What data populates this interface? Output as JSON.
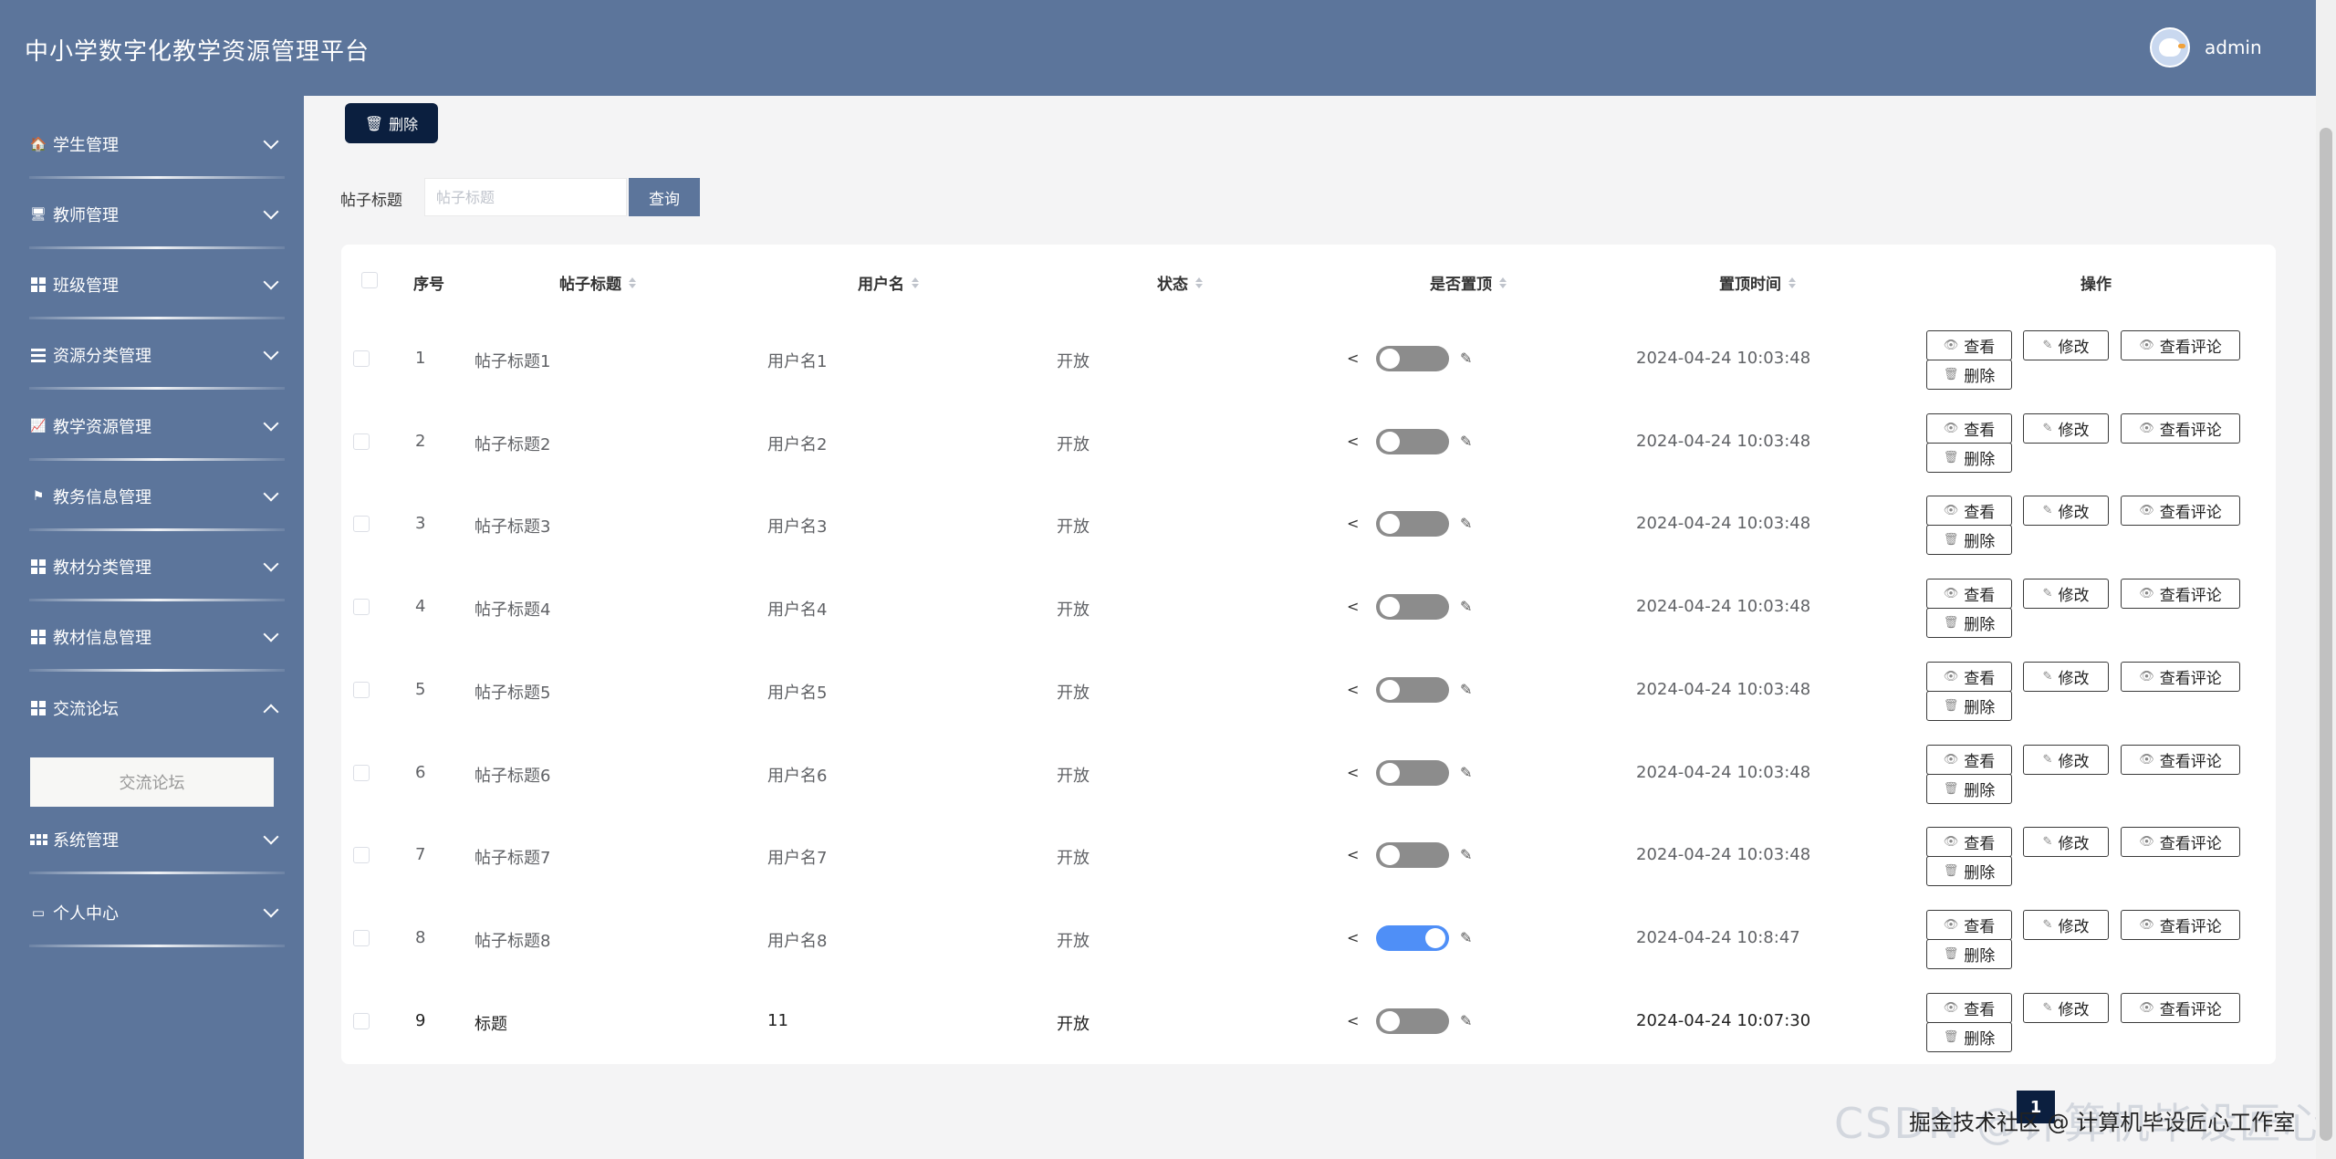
{
  "header": {
    "title": "中小学数字化教学资源管理平台",
    "username": "admin"
  },
  "sidebar": {
    "items": [
      {
        "label": "学生管理",
        "icon": "student-icon"
      },
      {
        "label": "教师管理",
        "icon": "monitor-icon"
      },
      {
        "label": "班级管理",
        "icon": "grid-icon"
      },
      {
        "label": "资源分类管理",
        "icon": "list-icon"
      },
      {
        "label": "教学资源管理",
        "icon": "chart-icon"
      },
      {
        "label": "教务信息管理",
        "icon": "flag-icon"
      },
      {
        "label": "教材分类管理",
        "icon": "grid-icon"
      },
      {
        "label": "教材信息管理",
        "icon": "grid-icon"
      },
      {
        "label": "交流论坛",
        "icon": "grid-icon",
        "expanded": true
      },
      {
        "label": "系统管理",
        "icon": "table-icon"
      },
      {
        "label": "个人中心",
        "icon": "card-icon"
      }
    ],
    "submenu": {
      "label": "交流论坛"
    }
  },
  "toolbar": {
    "delete_label": "删除"
  },
  "search": {
    "label": "帖子标题",
    "placeholder": "帖子标题",
    "button": "查询"
  },
  "table": {
    "columns": [
      "序号",
      "帖子标题",
      "用户名",
      "状态",
      "是否置顶",
      "置顶时间",
      "操作"
    ],
    "rows": [
      {
        "index": "1",
        "title": "帖子标题1",
        "user": "用户名1",
        "status": "开放",
        "pinned": false,
        "time": "2024-04-24 10:03:48"
      },
      {
        "index": "2",
        "title": "帖子标题2",
        "user": "用户名2",
        "status": "开放",
        "pinned": false,
        "time": "2024-04-24 10:03:48"
      },
      {
        "index": "3",
        "title": "帖子标题3",
        "user": "用户名3",
        "status": "开放",
        "pinned": false,
        "time": "2024-04-24 10:03:48"
      },
      {
        "index": "4",
        "title": "帖子标题4",
        "user": "用户名4",
        "status": "开放",
        "pinned": false,
        "time": "2024-04-24 10:03:48"
      },
      {
        "index": "5",
        "title": "帖子标题5",
        "user": "用户名5",
        "status": "开放",
        "pinned": false,
        "time": "2024-04-24 10:03:48"
      },
      {
        "index": "6",
        "title": "帖子标题6",
        "user": "用户名6",
        "status": "开放",
        "pinned": false,
        "time": "2024-04-24 10:03:48"
      },
      {
        "index": "7",
        "title": "帖子标题7",
        "user": "用户名7",
        "status": "开放",
        "pinned": false,
        "time": "2024-04-24 10:03:48"
      },
      {
        "index": "8",
        "title": "帖子标题8",
        "user": "用户名8",
        "status": "开放",
        "pinned": true,
        "time": "2024-04-24 10:8:47"
      },
      {
        "index": "9",
        "title": "标题",
        "user": "11",
        "status": "开放",
        "pinned": false,
        "time": "2024-04-24 10:07:30",
        "dark": true
      }
    ],
    "actions": {
      "view": "查看",
      "edit": "修改",
      "comments": "查看评论",
      "delete": "删除"
    }
  },
  "pagination": {
    "current": "1"
  },
  "watermark": {
    "text": "掘金技术社区 @ 计算机毕设匠心工作室",
    "faint": "CSDN @计算机毕设匠心工作室"
  }
}
